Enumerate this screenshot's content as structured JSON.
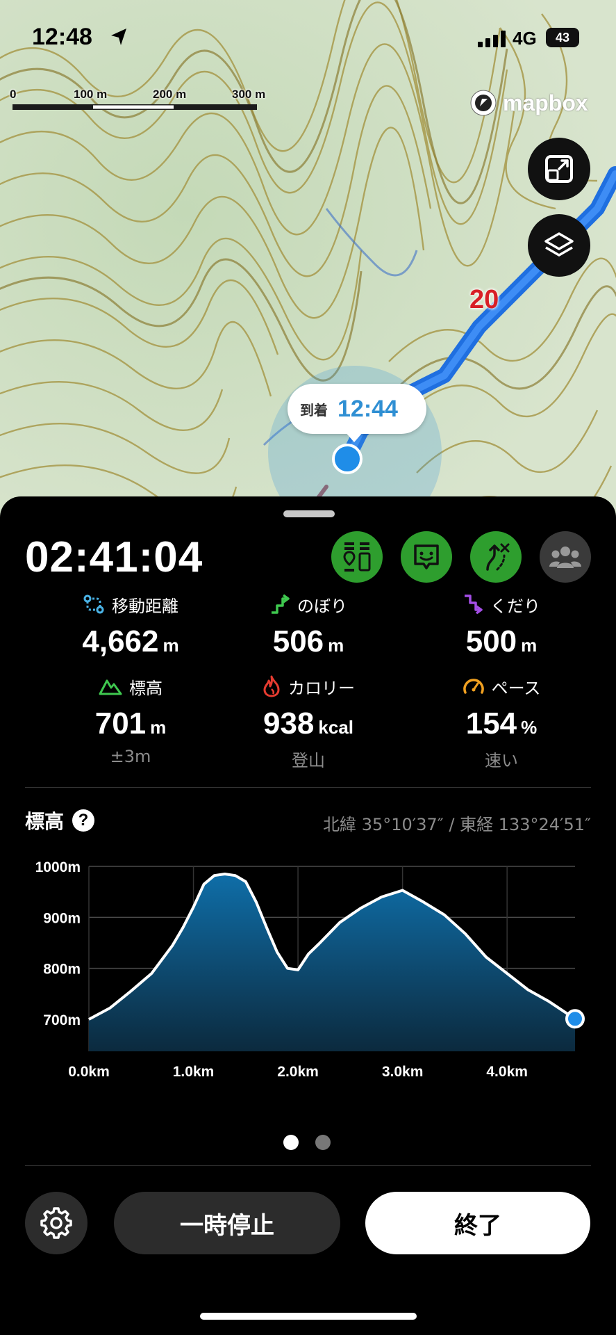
{
  "status_bar": {
    "time": "12:48",
    "network": "4G",
    "battery": "43"
  },
  "map": {
    "scale_labels": [
      "0",
      "100 m",
      "200 m",
      "300 m"
    ],
    "attribution": "mapbox",
    "route_marker": "20",
    "arrival": {
      "label": "到着",
      "time": "12:44"
    },
    "icons": [
      "location-arrow-icon",
      "fit-route-icon",
      "layers-icon"
    ]
  },
  "sheet": {
    "elapsed_time": "02:41:04",
    "action_icons": [
      "trail-markers-icon",
      "chat-icon",
      "route-deviation-icon",
      "group-icon"
    ],
    "stats": [
      {
        "label": "移動距離",
        "value": "4,662",
        "unit": "m",
        "sub": "",
        "icon": "distance-icon",
        "color": "#4ab3e6"
      },
      {
        "label": "のぼり",
        "value": "506",
        "unit": "m",
        "sub": "",
        "icon": "ascent-icon",
        "color": "#3fc84f"
      },
      {
        "label": "くだり",
        "value": "500",
        "unit": "m",
        "sub": "",
        "icon": "descent-icon",
        "color": "#a44ee6"
      },
      {
        "label": "標高",
        "value": "701",
        "unit": "m",
        "sub": "±3m",
        "icon": "mountain-icon",
        "color": "#3fc84f"
      },
      {
        "label": "カロリー",
        "value": "938",
        "unit": "kcal",
        "sub": "登山",
        "icon": "flame-icon",
        "color": "#e63b30"
      },
      {
        "label": "ペース",
        "value": "154",
        "unit": "%",
        "sub": "速い",
        "icon": "speedometer-icon",
        "color": "#f0a020"
      }
    ],
    "elevation_title": "標高",
    "coordinates": "北緯 35°10′37″ / 東経 133°24′51″",
    "page_indicator": {
      "count": 2,
      "active": 0
    },
    "buttons": {
      "pause": "一時停止",
      "end": "終了"
    }
  },
  "chart_data": {
    "type": "area",
    "xlabel": "",
    "ylabel": "",
    "x_tick_labels": [
      "0.0km",
      "1.0km",
      "2.0km",
      "3.0km",
      "4.0km"
    ],
    "y_tick_labels": [
      "1000m",
      "900m",
      "800m",
      "700m"
    ],
    "xlim": [
      0,
      4.65
    ],
    "ylim": [
      670,
      1000
    ],
    "grid": true,
    "x": [
      0,
      0.2,
      0.4,
      0.6,
      0.8,
      0.9,
      1.0,
      1.1,
      1.2,
      1.3,
      1.4,
      1.5,
      1.6,
      1.7,
      1.8,
      1.9,
      2.0,
      2.1,
      2.2,
      2.4,
      2.6,
      2.8,
      3.0,
      3.2,
      3.4,
      3.6,
      3.8,
      4.0,
      4.2,
      4.4,
      4.65
    ],
    "y": [
      700,
      722,
      755,
      790,
      845,
      880,
      920,
      965,
      982,
      985,
      982,
      970,
      930,
      880,
      832,
      800,
      797,
      828,
      848,
      890,
      918,
      940,
      953,
      930,
      905,
      868,
      822,
      790,
      758,
      735,
      701
    ],
    "current_point": {
      "x": 4.65,
      "y": 701
    }
  }
}
